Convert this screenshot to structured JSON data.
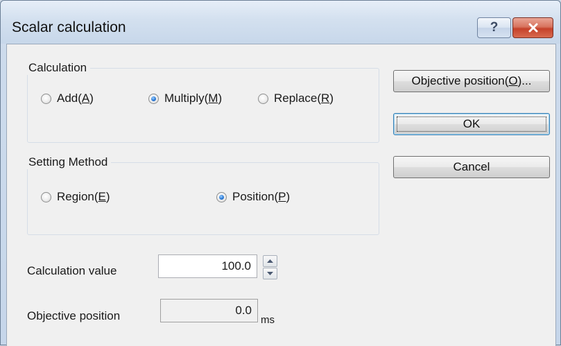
{
  "window": {
    "title": "Scalar calculation",
    "help_label": "?",
    "close_label": "×"
  },
  "calculation": {
    "legend": "Calculation",
    "options": [
      {
        "label": "Add(",
        "hotkey": "A",
        "suffix": ")",
        "checked": false
      },
      {
        "label": "Multiply(",
        "hotkey": "M",
        "suffix": ")",
        "checked": true
      },
      {
        "label": "Replace(",
        "hotkey": "R",
        "suffix": ")",
        "checked": false
      }
    ]
  },
  "setting_method": {
    "legend": "Setting Method",
    "options": [
      {
        "label": "Region(",
        "hotkey": "E",
        "suffix": ")",
        "checked": false
      },
      {
        "label": "Position(",
        "hotkey": "P",
        "suffix": ")",
        "checked": true
      }
    ]
  },
  "buttons": {
    "objective_position": {
      "label": "Objective position(",
      "hotkey": "O",
      "suffix": ")..."
    },
    "ok": "OK",
    "cancel": "Cancel"
  },
  "fields": {
    "calculation_value": {
      "label": "Calculation value",
      "value": "100.0"
    },
    "objective_position": {
      "label": "Objective position",
      "value": "0.0",
      "unit": "ms"
    }
  },
  "icons": {
    "spin_up": "triangle-up-icon",
    "spin_down": "triangle-down-icon"
  }
}
